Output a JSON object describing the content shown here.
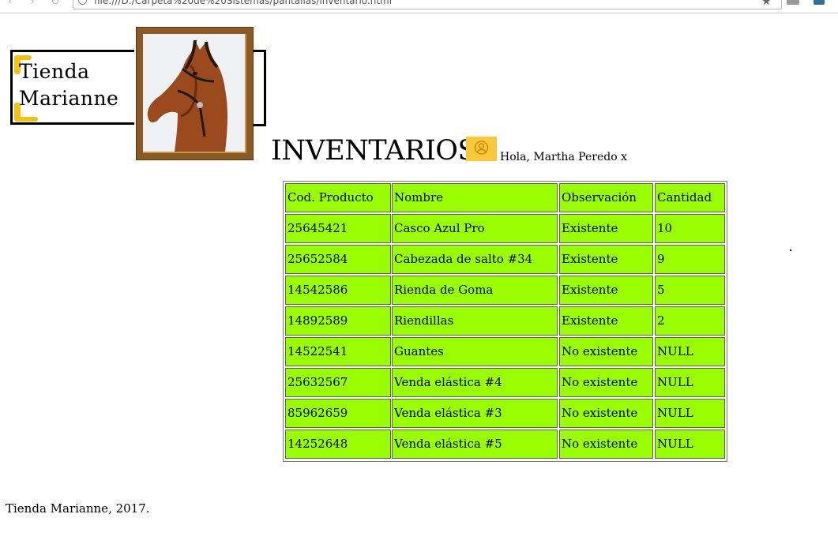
{
  "browser": {
    "url": "file:///D:/Carpeta%20de%20Sistemas/pantallas/inventario.html"
  },
  "logo": {
    "line1": "Tienda",
    "line2": "Marianne"
  },
  "header": {
    "title": "INVENTARIOS",
    "greeting": "Hola, Martha Peredo x"
  },
  "table": {
    "columns": [
      "Cod. Producto",
      "Nombre",
      "Observación",
      "Cantidad"
    ],
    "rows": [
      [
        "25645421",
        "Casco Azul Pro",
        "Existente",
        "10"
      ],
      [
        "25652584",
        "Cabezada de salto #34",
        "Existente",
        "9"
      ],
      [
        "14542586",
        "Rienda de Goma",
        "Existente",
        "5"
      ],
      [
        "14892589",
        "Riendillas",
        "Existente",
        "2"
      ],
      [
        "14522541",
        "Guantes",
        "No existente",
        "NULL"
      ],
      [
        "25632567",
        "Venda elástica #4",
        "No existente",
        "NULL"
      ],
      [
        "85962659",
        "Venda elástica #3",
        "No existente",
        "NULL"
      ],
      [
        "14252648",
        "Venda elástica #5",
        "No existente",
        "NULL"
      ]
    ]
  },
  "footer": {
    "text": "Tienda Marianne, 2017."
  },
  "colors": {
    "table_cell": "#99ff00",
    "logo_accent": "#f2c315",
    "user_icon_bg": "#f9c93a"
  },
  "icons": [
    "horse-photo",
    "user-icon",
    "info-icon",
    "star-icon"
  ]
}
